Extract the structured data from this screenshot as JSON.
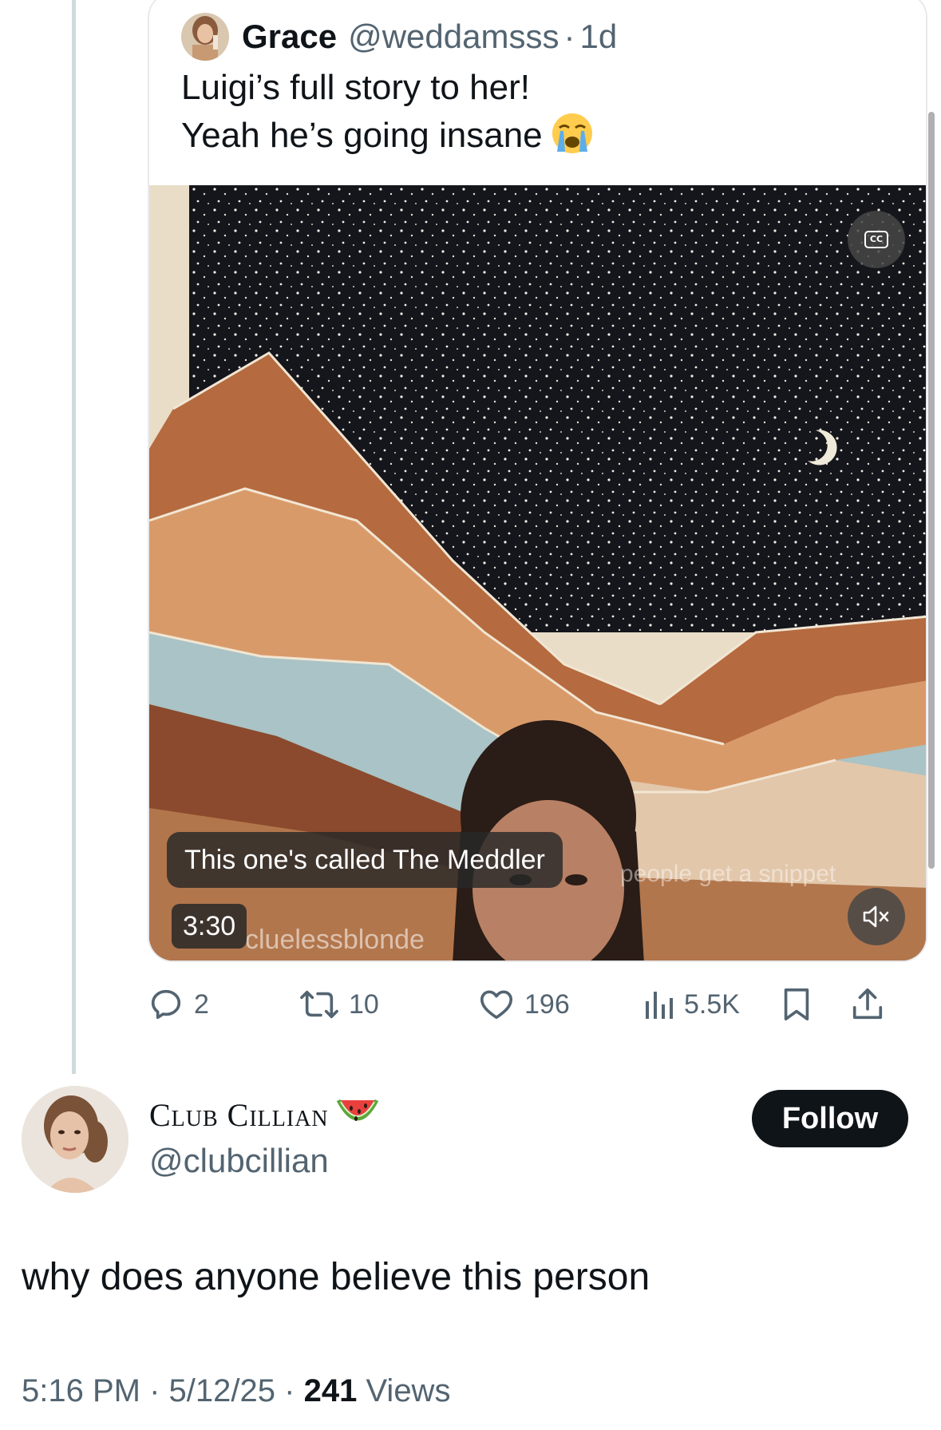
{
  "quoted_tweet": {
    "author_name": "Grace",
    "author_handle": "@weddamsss",
    "separator": "·",
    "time_ago": "1d",
    "text_line_1": "Luigi’s full story to her!",
    "text_line_2": "Yeah he’s going insane",
    "text_emoji": "loudly-crying-face-emoji",
    "video": {
      "caption": "This one's called The Meddler",
      "duration": "3:30",
      "watermark_left": "cluelessblonde",
      "watermark_right": "people get a snippet",
      "cc_label": "CC"
    }
  },
  "actions": {
    "replies": "2",
    "reposts": "10",
    "likes": "196",
    "views": "5.5K"
  },
  "main_tweet": {
    "author_name": "Club Cillian",
    "name_emoji": "watermelon-emoji",
    "author_handle": "@clubcillian",
    "follow_label": "Follow",
    "text": "why does anyone believe this person",
    "time": "5:16 PM",
    "separator": "·",
    "date": "5/12/25",
    "views_count": "241",
    "views_label": "Views"
  },
  "colors": {
    "text_primary": "#0f1419",
    "text_secondary": "#536471",
    "border": "#e7eaed",
    "thread_line": "#cfd9de",
    "button_dark": "#0f1419"
  }
}
